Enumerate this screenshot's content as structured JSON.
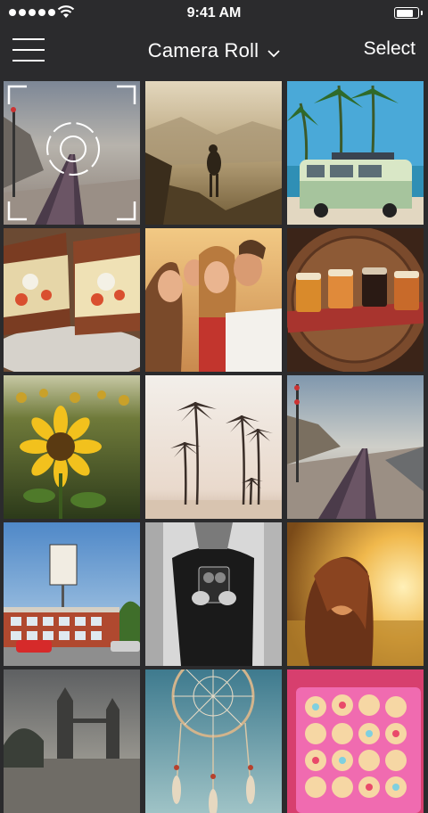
{
  "status_bar": {
    "time": "9:41 AM",
    "battery_level": 0.85
  },
  "nav": {
    "title": "Camera Roll",
    "select_label": "Select"
  },
  "photos": [
    {
      "name": "railway-tracks-cliff",
      "selected": true
    },
    {
      "name": "hiker-on-mountain"
    },
    {
      "name": "van-under-palms"
    },
    {
      "name": "sandwiches"
    },
    {
      "name": "friends-selfie"
    },
    {
      "name": "beer-flight"
    },
    {
      "name": "sunflower-field"
    },
    {
      "name": "palm-trees-sunset"
    },
    {
      "name": "railway-tracks-coast"
    },
    {
      "name": "vintage-building-sign"
    },
    {
      "name": "man-with-camera"
    },
    {
      "name": "woman-golden-field"
    },
    {
      "name": "tower-bridge"
    },
    {
      "name": "dreamcatcher"
    },
    {
      "name": "cupcakes"
    }
  ]
}
